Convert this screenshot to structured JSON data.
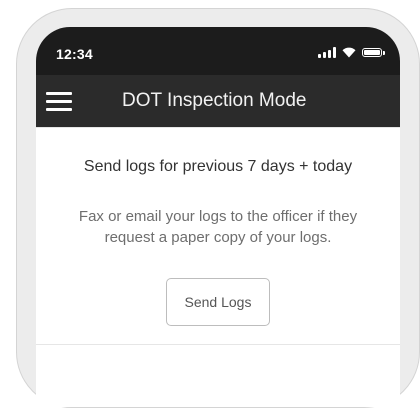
{
  "status_bar": {
    "time": "12:34"
  },
  "app_bar": {
    "title": "DOT Inspection Mode"
  },
  "card": {
    "heading": "Send logs for previous 7 days + today",
    "description": "Fax or email your logs to the officer if they request a paper copy of your logs.",
    "button_label": "Send Logs"
  },
  "icons": {
    "menu": "hamburger-menu-icon",
    "signal": "cellular-signal-icon",
    "wifi": "wifi-icon",
    "battery": "battery-icon"
  }
}
